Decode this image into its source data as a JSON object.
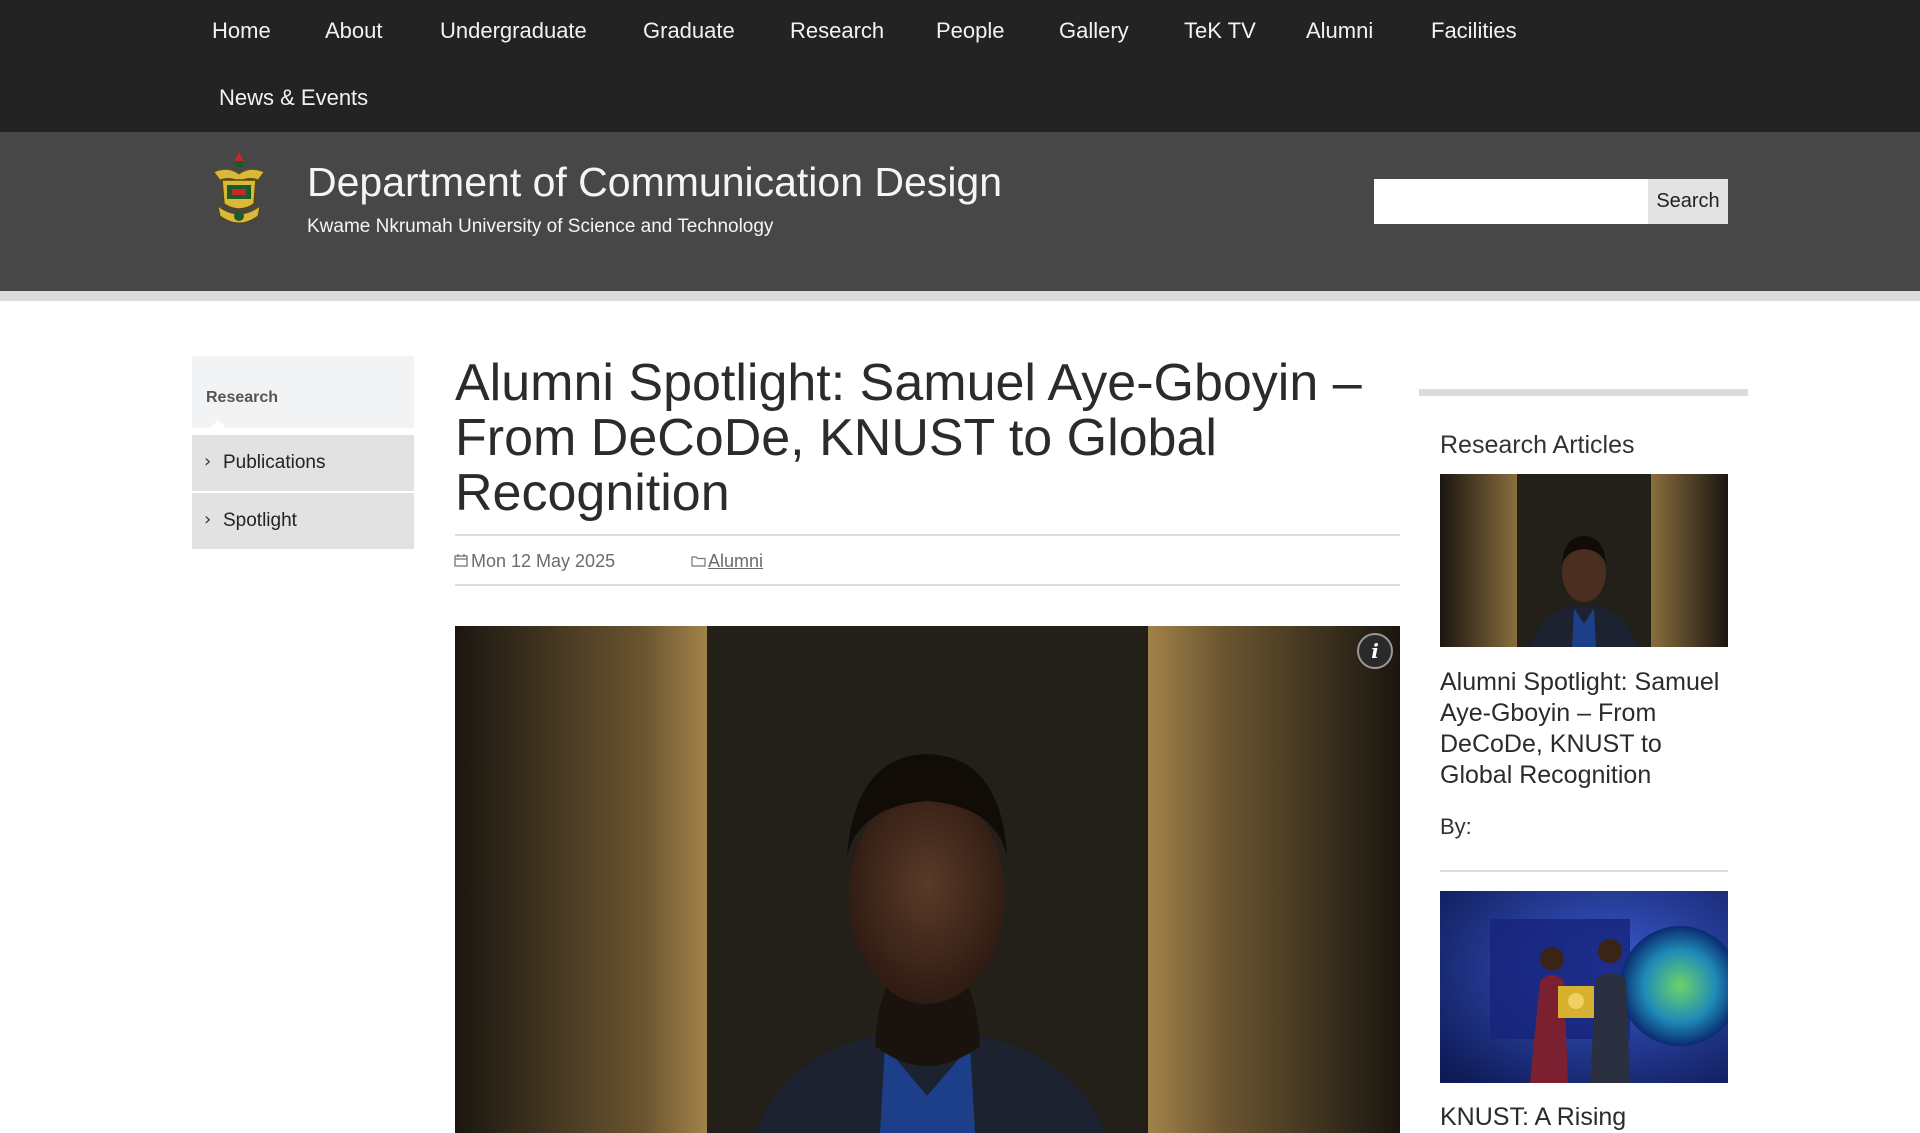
{
  "nav": {
    "items": [
      "Home",
      "About",
      "Undergraduate",
      "Graduate",
      "Research",
      "People",
      "Gallery",
      "TeK TV",
      "Alumni",
      "Facilities",
      "News & Events"
    ]
  },
  "header": {
    "title": "Department of Communication Design",
    "subtitle": "Kwame Nkrumah University of Science and Technology",
    "logo_icon": "knust-crest-icon",
    "search": {
      "placeholder": "",
      "value": "",
      "button_label": "Search"
    }
  },
  "sidebar": {
    "heading": "Research",
    "items": [
      {
        "label": "Publications",
        "icon": "chevron-right-icon"
      },
      {
        "label": "Spotlight",
        "icon": "chevron-right-icon"
      }
    ]
  },
  "article": {
    "title": "Alumni Spotlight: Samuel Aye-Gboyin – From DeCoDe, KNUST to Global Recognition",
    "date": "Mon 12 May 2025",
    "category": "Alumni",
    "info_label": "i"
  },
  "related": {
    "heading": "Research Articles",
    "items": [
      {
        "title": "Alumni Spotlight: Samuel Aye-Gboyin – From DeCoDe, KNUST to Global Recognition",
        "byline": "By:"
      },
      {
        "title": "KNUST: A Rising"
      }
    ]
  },
  "colors": {
    "nav_bg": "#232323",
    "header_bg": "#474747",
    "sidebar_item_bg": "#e2e2e2",
    "sidebar_head_bg": "#f2f3f4"
  }
}
